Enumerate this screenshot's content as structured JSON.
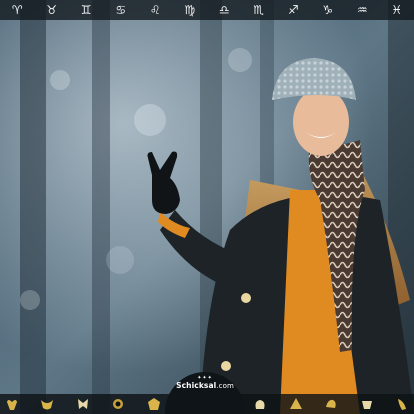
{
  "zodiac_bar": {
    "symbols": [
      "♈",
      "♉",
      "♊",
      "♋",
      "♌",
      "♍",
      "♎",
      "♏",
      "♐",
      "♑",
      "♒",
      "♓"
    ]
  },
  "logo": {
    "brand": "Schicksal",
    "suffix": ".com",
    "icon": "stars-icon"
  },
  "bottom_bar": {
    "icons": [
      "aries-gold-icon",
      "taurus-gold-icon",
      "gemini-gold-icon",
      "cancer-gold-icon",
      "leo-gold-icon",
      "virgo-gold-icon",
      "libra-gold-icon",
      "scorpio-gold-icon",
      "sagittarius-gold-icon",
      "capricorn-gold-icon",
      "aquarius-gold-icon",
      "pisces-gold-icon"
    ]
  },
  "colors": {
    "bar_background": "#12181e",
    "symbol_color": "#f2f2f2",
    "gold": "#d9b44a"
  }
}
